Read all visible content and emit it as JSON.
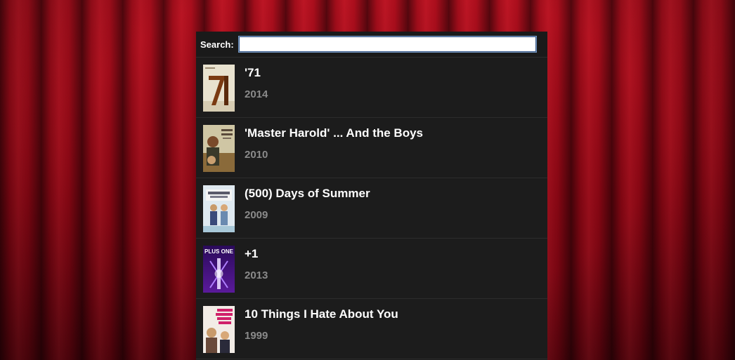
{
  "search": {
    "label": "Search:",
    "value": "",
    "placeholder": ""
  },
  "movies": [
    {
      "title": "'71",
      "year": "2014",
      "poster_icon": "poster-71"
    },
    {
      "title": "'Master Harold' ... And the Boys",
      "year": "2010",
      "poster_icon": "poster-master-harold"
    },
    {
      "title": "(500) Days of Summer",
      "year": "2009",
      "poster_icon": "poster-500-days-of-summer"
    },
    {
      "title": "+1",
      "year": "2013",
      "poster_icon": "poster-plus-one"
    },
    {
      "title": "10 Things I Hate About You",
      "year": "1999",
      "poster_icon": "poster-10-things"
    }
  ],
  "poster_texts": {
    "plus_one": "PLUS ONE"
  },
  "colors": {
    "curtain": "#8c0714",
    "panel": "#1c1c1c",
    "title": "#ffffff",
    "year": "#8a8a8a"
  }
}
